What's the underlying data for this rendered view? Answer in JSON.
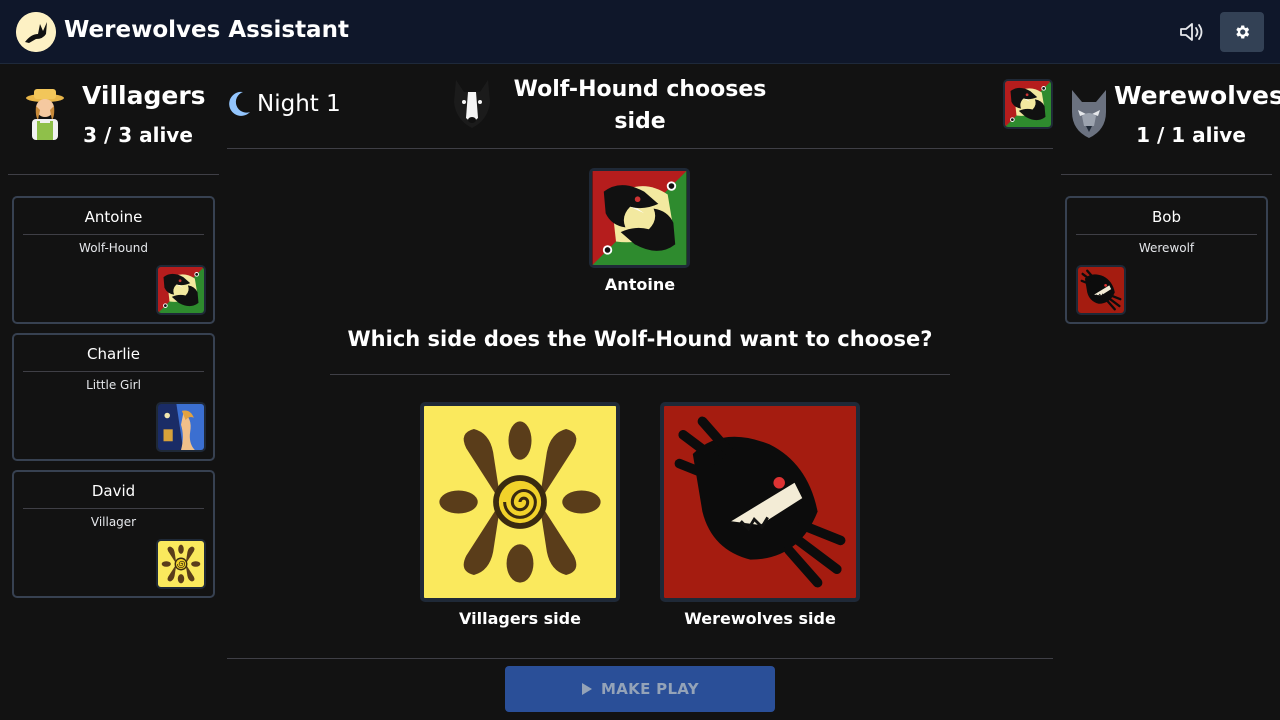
{
  "app": {
    "title": "Werewolves Assistant"
  },
  "header": {
    "sound_icon": "speaker-icon",
    "settings_icon": "gear-icon"
  },
  "villagers": {
    "name": "Villagers",
    "alive": "3 / 3 alive",
    "players": [
      {
        "name": "Antoine",
        "role": "Wolf-Hound",
        "card": "wolf-hound"
      },
      {
        "name": "Charlie",
        "role": "Little Girl",
        "card": "little-girl"
      },
      {
        "name": "David",
        "role": "Villager",
        "card": "villager"
      }
    ]
  },
  "werewolves": {
    "name": "Werewolves",
    "alive": "1 / 1 alive",
    "players": [
      {
        "name": "Bob",
        "role": "Werewolf",
        "card": "werewolf"
      }
    ]
  },
  "phase": {
    "label": "Night 1",
    "icon": "moon-icon"
  },
  "step": {
    "title": "Wolf-Hound chooses side"
  },
  "target": {
    "name": "Antoine"
  },
  "question": "Which side does the Wolf-Hound want to choose?",
  "choices": [
    {
      "label": "Villagers side"
    },
    {
      "label": "Werewolves side"
    }
  ],
  "actions": {
    "make_play": "MAKE PLAY"
  },
  "colors": {
    "header_bg": "#0f172a",
    "page_bg": "#121212",
    "button_bg": "#2a4f98",
    "card_border": "#374151"
  }
}
